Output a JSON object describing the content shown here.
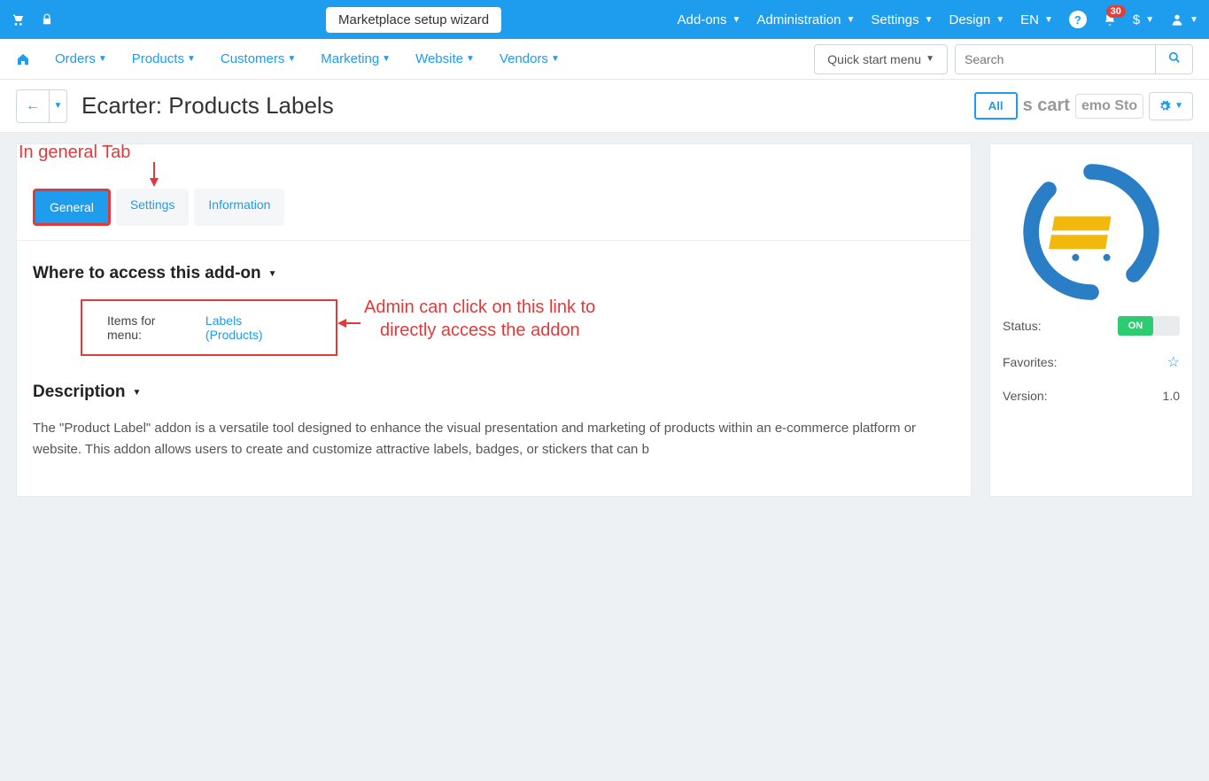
{
  "topbar": {
    "wizard": "Marketplace setup wizard",
    "menu": [
      "Add-ons",
      "Administration",
      "Settings",
      "Design",
      "EN",
      "$"
    ],
    "notifications": "30"
  },
  "nav": {
    "items": [
      "Orders",
      "Products",
      "Customers",
      "Marketing",
      "Website",
      "Vendors"
    ],
    "quick_start": "Quick start menu",
    "search_placeholder": "Search"
  },
  "titlebar": {
    "title": "Ecarter: Products Labels",
    "all_btn": "All",
    "ghost1": "s cart",
    "ghost2": "emo Sto"
  },
  "annotations": {
    "tab_hint": "In general Tab",
    "link_hint_l1": "Admin can click on this link to",
    "link_hint_l2": "directly access the addon"
  },
  "tabs": [
    "General",
    "Settings",
    "Information"
  ],
  "section_where": "Where to access this add-on",
  "items_for_menu_label": "Items for menu:",
  "items_for_menu_link": "Labels (Products)",
  "section_desc": "Description",
  "description_text": "The \"Product Label\" addon is a versatile tool designed to enhance the visual presentation and marketing of products within an e-commerce platform or website. This addon allows users to create and customize attractive labels, badges, or stickers that can b",
  "side": {
    "status_label": "Status:",
    "status_on": "ON",
    "favorites_label": "Favorites:",
    "version_label": "Version:",
    "version_value": "1.0"
  }
}
